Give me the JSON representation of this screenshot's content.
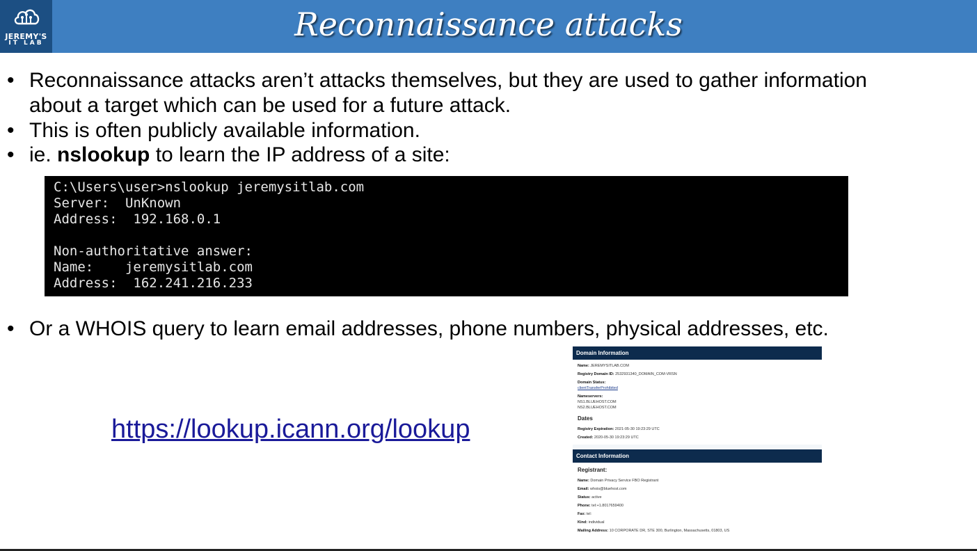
{
  "header": {
    "title": "Reconnaissance attacks",
    "logo_line1": "JEREMY'S",
    "logo_line2": "IT LAB"
  },
  "bullets": {
    "b1_line1": "Reconnaissance attacks aren’t attacks themselves, but they are used to gather information",
    "b1_line2": "about a target which can be used for a future attack.",
    "b2": "This is often publicly available information.",
    "b3_prefix": "ie. ",
    "b3_bold": "nslookup",
    "b3_suffix": " to learn the IP address of a site:",
    "b4": "Or a WHOIS query to learn email addresses, phone numbers, physical addresses, etc."
  },
  "terminal": {
    "lines": [
      "C:\\Users\\user>nslookup jeremysitlab.com",
      "Server:  UnKnown",
      "Address:  192.168.0.1",
      "",
      "Non-authoritative answer:",
      "Name:    jeremysitlab.com",
      "Address:  162.241.216.233"
    ]
  },
  "link": {
    "text": "https://lookup.icann.org/lookup"
  },
  "whois": {
    "domain_header": "Domain Information",
    "name_label": "Name:",
    "name_value": "JEREMYSITLAB.COM",
    "registry_id_label": "Registry Domain ID:",
    "registry_id_value": "2532931340_DOMAIN_COM-VRSN",
    "status_label": "Domain Status:",
    "status_value": "clientTransferProhibited",
    "nameservers_label": "Nameservers:",
    "ns1": "NS1.BLUEHOST.COM",
    "ns2": "NS2.BLUEHOST.COM",
    "dates_header": "Dates",
    "expiration_label": "Registry Expiration:",
    "expiration_value": "2021-05-30 19:23:29 UTC",
    "created_label": "Created:",
    "created_value": "2020-05-30 19:23:29 UTC",
    "contact_header": "Contact Information",
    "registrant_header": "Registrant:",
    "c_name_label": "Name:",
    "c_name_value": "Domain Privacy Service FBO Registrant",
    "c_email_label": "Email:",
    "c_email_value": "whois@bluehost.com",
    "c_status_label": "Status:",
    "c_status_value": "active",
    "c_phone_label": "Phone:",
    "c_phone_value": "tel:+1.8017659400",
    "c_fax_label": "Fax:",
    "c_fax_value": "tel:",
    "c_kind_label": "Kind:",
    "c_kind_value": "individual",
    "c_mail_label": "Mailing Address:",
    "c_mail_value": "10 CORPORATE DR, STE 300, Burlington, Massachusetts, 01803, US"
  },
  "colors": {
    "header_bg": "#3e7fc1",
    "logo_bg": "#1c4f83",
    "terminal_bg": "#000000",
    "link": "#1a1a99",
    "whois_header": "#0d2b4d"
  }
}
